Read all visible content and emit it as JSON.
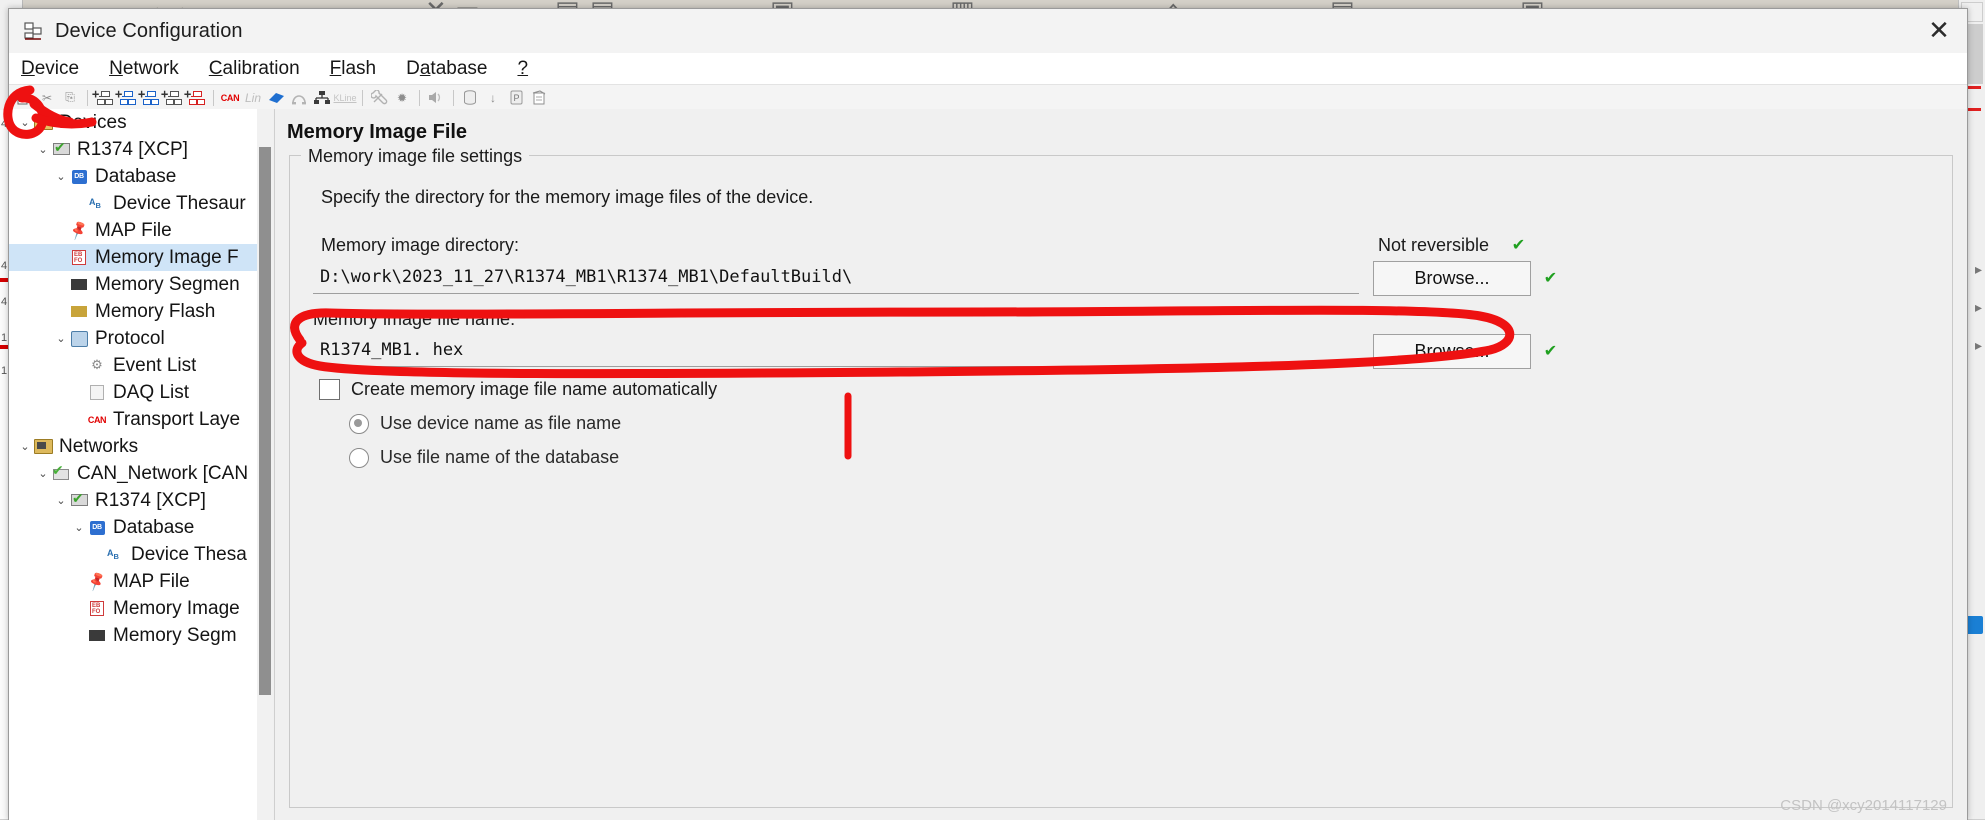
{
  "window": {
    "title": "Device Configuration",
    "title_icon": "device-config-icon",
    "close_label": "✕"
  },
  "menubar": {
    "items": [
      {
        "pre": "",
        "mn": "D",
        "post": "evice"
      },
      {
        "pre": "",
        "mn": "N",
        "post": "etwork"
      },
      {
        "pre": "",
        "mn": "C",
        "post": "alibration"
      },
      {
        "pre": "",
        "mn": "F",
        "post": "lash"
      },
      {
        "pre": "D",
        "mn": "a",
        "post": "tabase"
      },
      {
        "pre": "",
        "mn": "?",
        "post": ""
      }
    ]
  },
  "toolbar": {
    "groups": [
      [
        "new-config-icon",
        "cut-icon",
        "paste-icon"
      ],
      [
        "add-device-icon",
        "add-device-blue-icon",
        "add-device-net-icon",
        "add-device-list-icon",
        "add-device-red-icon"
      ],
      [
        "can-icon",
        "lin-icon",
        "flexray-icon",
        "most-icon",
        "ethernet-icon",
        "kline-icon"
      ],
      [
        "wrench-icon",
        "crossed-tools-icon"
      ],
      [
        "speaker-icon"
      ],
      [
        "database-icon",
        "download-icon",
        "protocol-icon",
        "report-icon"
      ]
    ],
    "can_label": "CAN",
    "lin_label": "Lin",
    "kline_label": "KLine"
  },
  "tree": {
    "items": [
      {
        "indent": 0,
        "chev": "⌄",
        "icon": "folder-devices-icon",
        "label": "Devices",
        "selected": false
      },
      {
        "indent": 1,
        "chev": "⌄",
        "icon": "device-icon",
        "label": "R1374 [XCP]",
        "selected": false
      },
      {
        "indent": 2,
        "chev": "⌄",
        "icon": "database-icon",
        "label": "Database",
        "selected": false
      },
      {
        "indent": 3,
        "chev": "",
        "icon": "thesaurus-icon",
        "label": "Device Thesaur",
        "selected": false
      },
      {
        "indent": 2,
        "chev": "",
        "icon": "map-file-icon",
        "label": "MAP File",
        "selected": false
      },
      {
        "indent": 2,
        "chev": "",
        "icon": "memory-image-icon",
        "label": "Memory Image F",
        "selected": true
      },
      {
        "indent": 2,
        "chev": "",
        "icon": "memory-segment-icon",
        "label": "Memory Segmen",
        "selected": false
      },
      {
        "indent": 2,
        "chev": "",
        "icon": "memory-flash-icon",
        "label": "Memory Flash",
        "selected": false
      },
      {
        "indent": 2,
        "chev": "⌄",
        "icon": "protocol-icon",
        "label": "Protocol",
        "selected": false
      },
      {
        "indent": 3,
        "chev": "",
        "icon": "event-list-icon",
        "label": "Event List",
        "selected": false
      },
      {
        "indent": 3,
        "chev": "",
        "icon": "daq-list-icon",
        "label": "DAQ List",
        "selected": false
      },
      {
        "indent": 3,
        "chev": "",
        "icon": "transport-layer-icon",
        "label": "Transport Laye",
        "selected": false
      },
      {
        "indent": 0,
        "chev": "⌄",
        "icon": "folder-networks-icon",
        "label": "Networks",
        "selected": false
      },
      {
        "indent": 1,
        "chev": "⌄",
        "icon": "can-network-icon",
        "label": "CAN_Network [CAN",
        "selected": false
      },
      {
        "indent": 2,
        "chev": "⌄",
        "icon": "device-icon",
        "label": "R1374 [XCP]",
        "selected": false
      },
      {
        "indent": 3,
        "chev": "⌄",
        "icon": "database-icon",
        "label": "Database",
        "selected": false
      },
      {
        "indent": 4,
        "chev": "",
        "icon": "thesaurus-icon",
        "label": "Device Thesa",
        "selected": false
      },
      {
        "indent": 3,
        "chev": "",
        "icon": "map-file-icon",
        "label": "MAP File",
        "selected": false
      },
      {
        "indent": 3,
        "chev": "",
        "icon": "memory-image-icon",
        "label": "Memory Image",
        "selected": false
      },
      {
        "indent": 3,
        "chev": "",
        "icon": "memory-segment-icon",
        "label": "Memory Segm",
        "selected": false
      }
    ]
  },
  "content": {
    "page_title": "Memory Image File",
    "group_legend": "Memory image file settings",
    "description": "Specify the directory for the memory image files of the device.",
    "directory_label": "Memory image directory:",
    "directory_value": "D:\\work\\2023_11_27\\R1374_MB1\\R1374_MB1\\DefaultBuild\\",
    "directory_browse_label": "Browse...",
    "not_reversible_label": "Not reversible",
    "filename_label": "Memory image file name:",
    "filename_value": "R1374_MB1. hex",
    "filename_browse_label": "Browse...",
    "status_ok_glyph": "✔",
    "auto_checkbox_label": "Create memory image file name automatically",
    "auto_checkbox_checked": false,
    "radio_options": [
      {
        "label": "Use device name as file name",
        "selected": true
      },
      {
        "label": "Use file name of the database",
        "selected": false
      }
    ]
  },
  "watermark": "CSDN @xcy2014117129",
  "colors": {
    "selection": "#cfe4f7",
    "annotation_red": "#ee1111",
    "ok_green": "#20a020",
    "can_red": "#e10000"
  },
  "backdrop": {
    "ruler_numbers": [
      "4",
      "4",
      "4",
      "1",
      "1"
    ]
  }
}
